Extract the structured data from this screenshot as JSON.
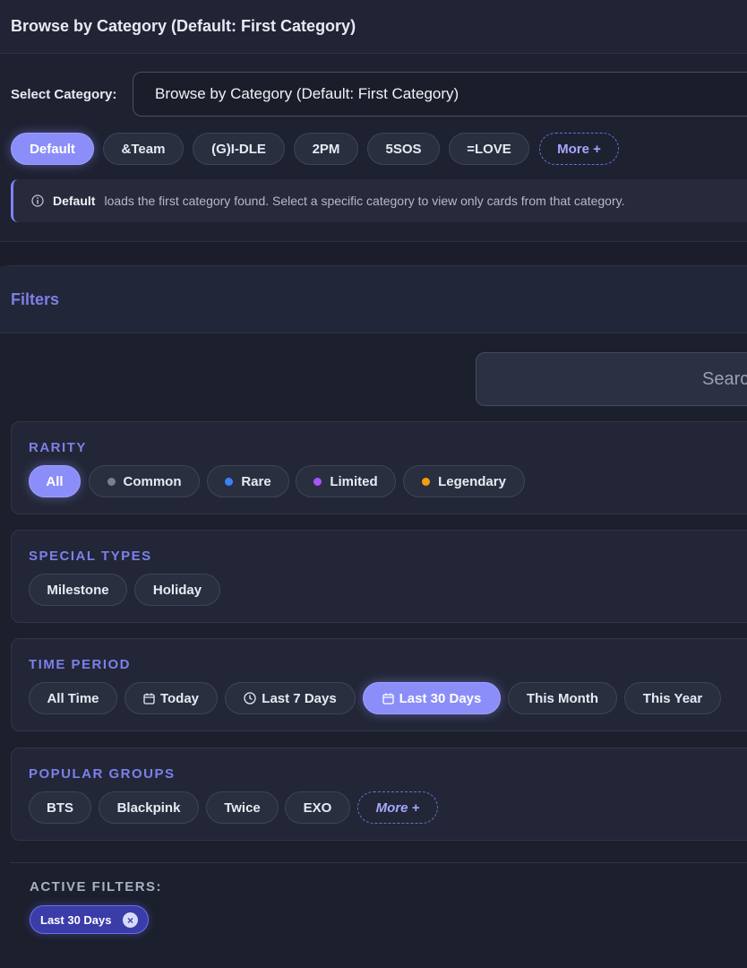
{
  "browse": {
    "title": "Browse by Category (Default: First Category)",
    "select_label": "Select Category:",
    "select_value": "Browse by Category (Default: First Category)",
    "categories": [
      "Default",
      "&Team",
      "(G)I-DLE",
      "2PM",
      "5SOS",
      "=LOVE"
    ],
    "more_label": "More +",
    "info_bold": "Default",
    "info_text": "loads the first category found. Select a specific category to view only cards from that category."
  },
  "filters": {
    "title": "Filters",
    "search_placeholder": "Search",
    "rarity": {
      "title": "RARITY",
      "options": [
        "All",
        "Common",
        "Rare",
        "Limited",
        "Legendary"
      ],
      "dot_colors": [
        "#7a7f90",
        "#3b82f6",
        "#a855f7",
        "#f59e0b"
      ]
    },
    "special_types": {
      "title": "SPECIAL TYPES",
      "options": [
        "Milestone",
        "Holiday"
      ]
    },
    "time_period": {
      "title": "TIME PERIOD",
      "options": [
        "All Time",
        "Today",
        "Last 7 Days",
        "Last 30 Days",
        "This Month",
        "This Year"
      ],
      "selected": "Last 30 Days"
    },
    "popular_groups": {
      "title": "POPULAR GROUPS",
      "options": [
        "BTS",
        "Blackpink",
        "Twice",
        "EXO"
      ],
      "more_label": "More +"
    },
    "active": {
      "title": "ACTIVE FILTERS:",
      "chips": [
        "Last 30 Days"
      ]
    }
  },
  "colors": {
    "accent": "#8b8ef8",
    "section_title": "#7c80ea"
  }
}
